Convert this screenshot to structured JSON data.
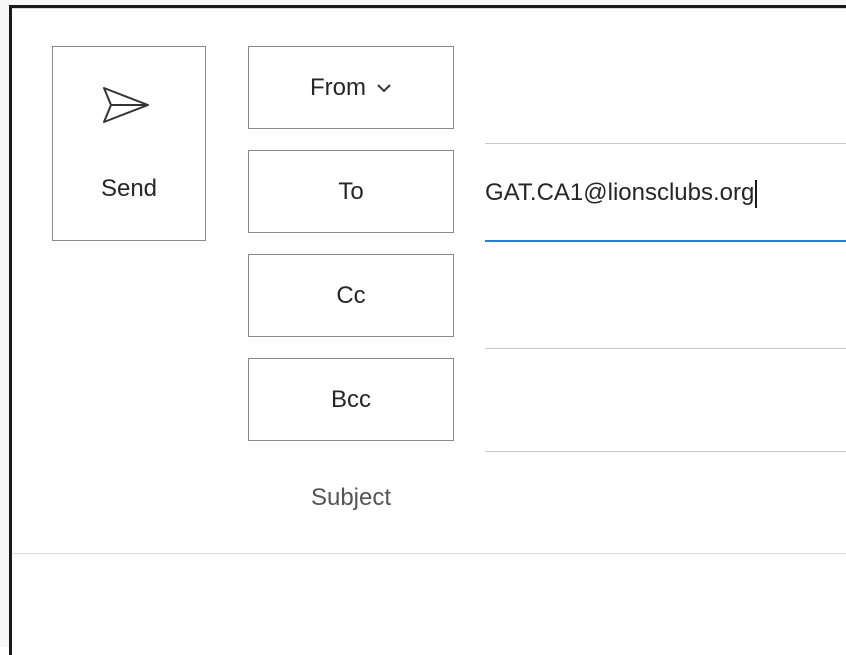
{
  "compose": {
    "send_label": "Send",
    "from_label": "From",
    "to_label": "To",
    "cc_label": "Cc",
    "bcc_label": "Bcc",
    "subject_label": "Subject",
    "to_value": "GAT.CA1@lionsclubs.org",
    "cc_value": "",
    "bcc_value": "",
    "subject_value": "",
    "body_value": ""
  },
  "colors": {
    "accent": "#2b7cd3",
    "border": "#8a8a8a",
    "text": "#262626"
  },
  "icons": {
    "send": "send-icon",
    "from_dropdown": "chevron-down-icon"
  }
}
